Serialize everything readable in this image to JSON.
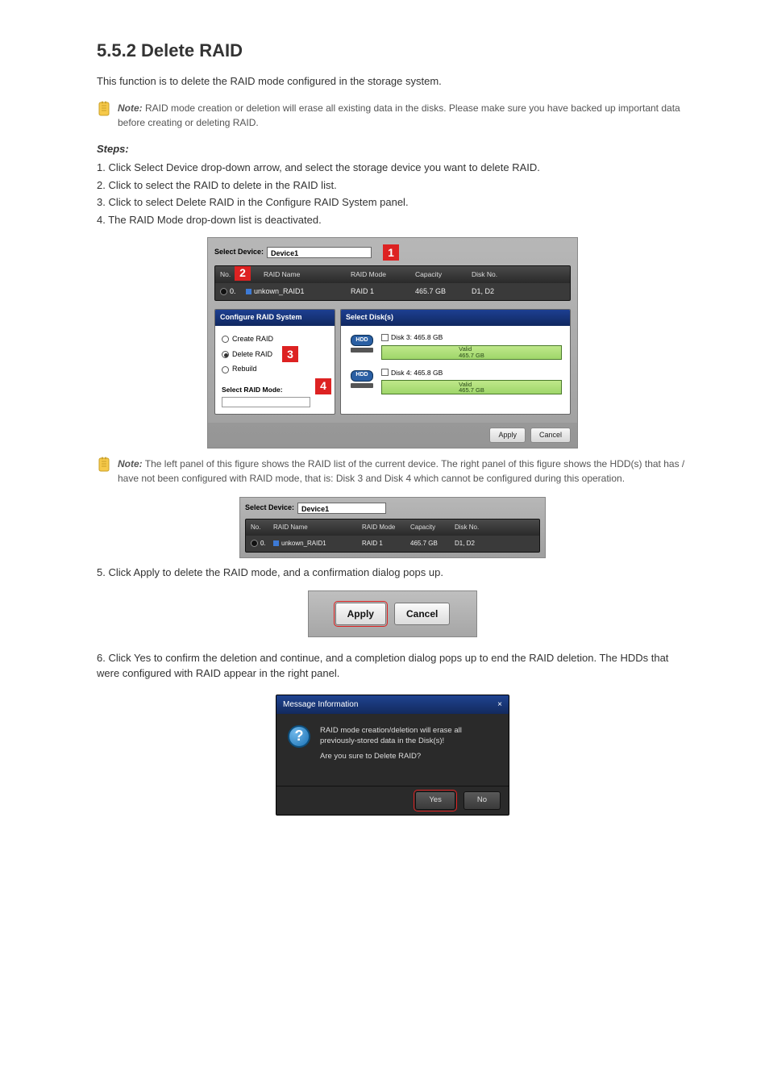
{
  "section": {
    "title": "5.5.2 Delete RAID",
    "intro": "This function is to delete the RAID mode configured in the storage system.",
    "stepsTitle": "Steps:",
    "warn1_em": "Note:",
    "warn1": "RAID mode creation or deletion will erase all existing data in the disks. Please make sure you have backed up important data before creating or deleting RAID."
  },
  "steps": {
    "s1": "1. Click Select Device drop-down arrow, and select the storage device you want to delete RAID.",
    "s2": "2. Click to select the RAID to delete in the RAID list.",
    "s3": "3. Click to select Delete RAID in the Configure RAID System panel.",
    "s4": "4. The RAID Mode drop-down list is deactivated."
  },
  "fig1": {
    "selectDeviceLabel": "Select Device:",
    "deviceValue": "Device1",
    "callouts": {
      "c1": "1",
      "c2": "2",
      "c3": "3",
      "c4": "4"
    },
    "head": {
      "no": "No.",
      "name": "RAID Name",
      "mode": "RAID Mode",
      "cap": "Capacity",
      "dn": "Disk No."
    },
    "row": {
      "no": "0.",
      "name": "unkown_RAID1",
      "mode": "RAID 1",
      "cap": "465.7 GB",
      "dn": "D1, D2"
    },
    "cfgHead": "Configure RAID System",
    "opt1": "Create RAID",
    "opt2": "Delete RAID",
    "opt3": "Rebuild",
    "modeLabel": "Select RAID Mode:",
    "diskHead": "Select Disk(s)",
    "disk3": "Disk 3: 465.8 GB",
    "disk4": "Disk 4: 465.8 GB",
    "barLine1": "Valid",
    "barLine2": "465.7 GB",
    "hdd": "HDD",
    "apply": "Apply",
    "cancel": "Cancel"
  },
  "note2": {
    "em": "Note:",
    "text": "The left panel of this figure shows the RAID list of the current device. The right panel of this figure shows the HDD(s) that has / have not been configured with RAID mode, that is: Disk 3 and Disk 4 which cannot be configured during this operation."
  },
  "s5": "5. Click Apply to delete the RAID mode, and a confirmation dialog pops up.",
  "s6": "6. Click Yes to confirm the deletion and continue, and a completion dialog pops up to end the RAID deletion. The HDDs that were configured with RAID appear in the right panel.",
  "strip": {
    "apply": "Apply",
    "cancel": "Cancel"
  },
  "dlg": {
    "title": "Message Information",
    "close": "×",
    "q": "?",
    "line1": "RAID mode creation/deletion will erase all previously-stored data in the Disk(s)!",
    "line2": "Are you sure to Delete RAID?",
    "yes": "Yes",
    "no": "No"
  }
}
